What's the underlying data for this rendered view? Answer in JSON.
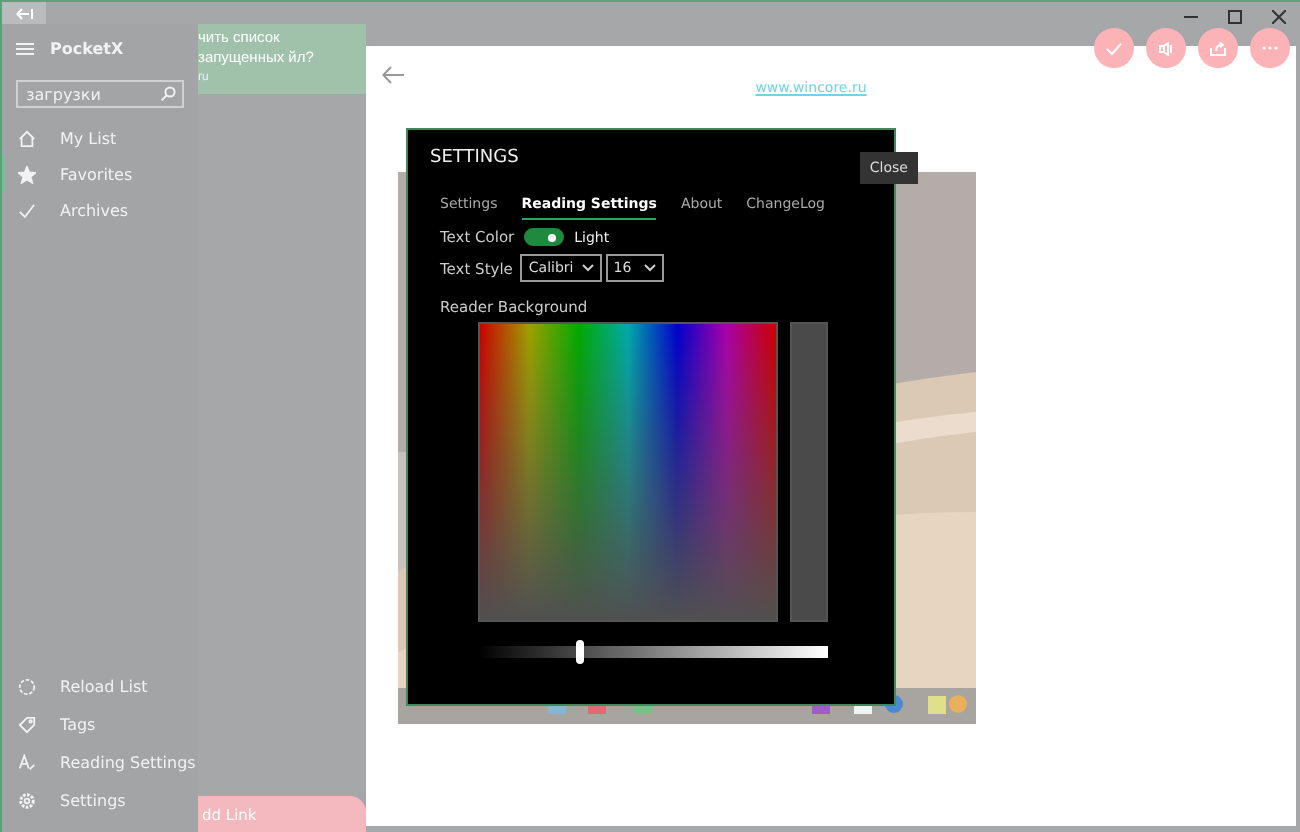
{
  "app": {
    "name": "PocketX"
  },
  "search": {
    "value": "загрузки"
  },
  "nav_items": [
    {
      "label": "My List",
      "selected": false
    },
    {
      "label": "Favorites",
      "selected": true
    },
    {
      "label": "Archives",
      "selected": false
    }
  ],
  "bottom_items": [
    {
      "label": "Reload List"
    },
    {
      "label": "Tags"
    },
    {
      "label": "Reading Settings"
    },
    {
      "label": "Settings"
    }
  ],
  "list_card": {
    "title": "чить список запущенных йл?",
    "source": "ru"
  },
  "add_link": {
    "label": "dd Link"
  },
  "article": {
    "link": "www.wincore.ru"
  },
  "settings_dialog": {
    "title": "SETTINGS",
    "close": "Close",
    "tabs": [
      {
        "label": "Settings",
        "selected": false
      },
      {
        "label": "Reading Settings",
        "selected": true
      },
      {
        "label": "About",
        "selected": false
      },
      {
        "label": "ChangeLog",
        "selected": false
      }
    ],
    "text_color": {
      "label": "Text Color",
      "on": true,
      "value": "Light"
    },
    "text_style": {
      "label": "Text Style",
      "font": "Calibri",
      "size": "16"
    },
    "reader_background": {
      "label": "Reader Background",
      "level": 0.29
    }
  }
}
